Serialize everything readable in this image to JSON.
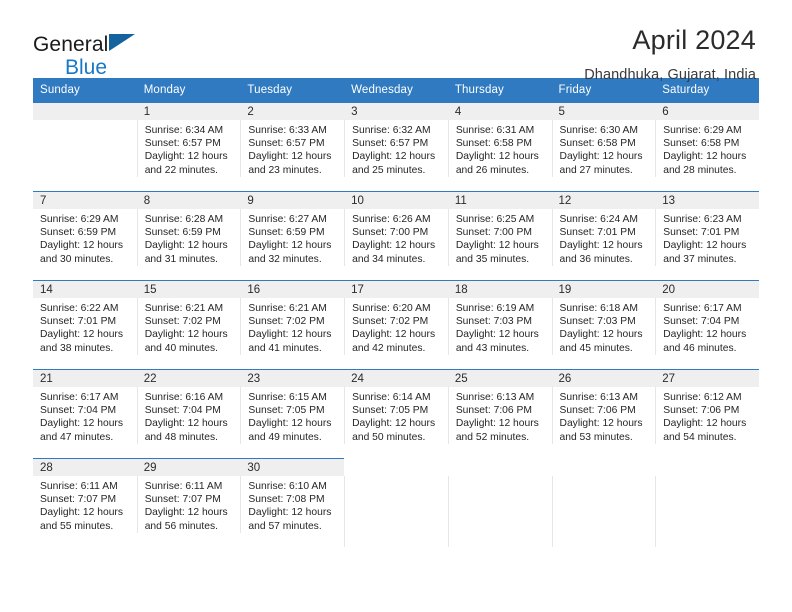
{
  "brand": {
    "line1": "General",
    "line2": "Blue",
    "triangle_color": "#14639e",
    "blue": "#1878c8"
  },
  "header": {
    "title": "April 2024",
    "subtitle": "Dhandhuka, Gujarat, India"
  },
  "theme": {
    "header_bg": "#2f7ac0",
    "daynum_bg": "#efefef",
    "text": "#262626"
  },
  "weekdays": [
    "Sunday",
    "Monday",
    "Tuesday",
    "Wednesday",
    "Thursday",
    "Friday",
    "Saturday"
  ],
  "labels": {
    "sunrise": "Sunrise:",
    "sunset": "Sunset:",
    "daylight": "Daylight:"
  },
  "weeks": [
    [
      {
        "day": "",
        "sunrise": "",
        "sunset": "",
        "daylight_line1": "",
        "daylight_line2": ""
      },
      {
        "day": "1",
        "sunrise": "Sunrise: 6:34 AM",
        "sunset": "Sunset: 6:57 PM",
        "daylight_line1": "Daylight: 12 hours",
        "daylight_line2": "and 22 minutes."
      },
      {
        "day": "2",
        "sunrise": "Sunrise: 6:33 AM",
        "sunset": "Sunset: 6:57 PM",
        "daylight_line1": "Daylight: 12 hours",
        "daylight_line2": "and 23 minutes."
      },
      {
        "day": "3",
        "sunrise": "Sunrise: 6:32 AM",
        "sunset": "Sunset: 6:57 PM",
        "daylight_line1": "Daylight: 12 hours",
        "daylight_line2": "and 25 minutes."
      },
      {
        "day": "4",
        "sunrise": "Sunrise: 6:31 AM",
        "sunset": "Sunset: 6:58 PM",
        "daylight_line1": "Daylight: 12 hours",
        "daylight_line2": "and 26 minutes."
      },
      {
        "day": "5",
        "sunrise": "Sunrise: 6:30 AM",
        "sunset": "Sunset: 6:58 PM",
        "daylight_line1": "Daylight: 12 hours",
        "daylight_line2": "and 27 minutes."
      },
      {
        "day": "6",
        "sunrise": "Sunrise: 6:29 AM",
        "sunset": "Sunset: 6:58 PM",
        "daylight_line1": "Daylight: 12 hours",
        "daylight_line2": "and 28 minutes."
      }
    ],
    [
      {
        "day": "7",
        "sunrise": "Sunrise: 6:29 AM",
        "sunset": "Sunset: 6:59 PM",
        "daylight_line1": "Daylight: 12 hours",
        "daylight_line2": "and 30 minutes."
      },
      {
        "day": "8",
        "sunrise": "Sunrise: 6:28 AM",
        "sunset": "Sunset: 6:59 PM",
        "daylight_line1": "Daylight: 12 hours",
        "daylight_line2": "and 31 minutes."
      },
      {
        "day": "9",
        "sunrise": "Sunrise: 6:27 AM",
        "sunset": "Sunset: 6:59 PM",
        "daylight_line1": "Daylight: 12 hours",
        "daylight_line2": "and 32 minutes."
      },
      {
        "day": "10",
        "sunrise": "Sunrise: 6:26 AM",
        "sunset": "Sunset: 7:00 PM",
        "daylight_line1": "Daylight: 12 hours",
        "daylight_line2": "and 34 minutes."
      },
      {
        "day": "11",
        "sunrise": "Sunrise: 6:25 AM",
        "sunset": "Sunset: 7:00 PM",
        "daylight_line1": "Daylight: 12 hours",
        "daylight_line2": "and 35 minutes."
      },
      {
        "day": "12",
        "sunrise": "Sunrise: 6:24 AM",
        "sunset": "Sunset: 7:01 PM",
        "daylight_line1": "Daylight: 12 hours",
        "daylight_line2": "and 36 minutes."
      },
      {
        "day": "13",
        "sunrise": "Sunrise: 6:23 AM",
        "sunset": "Sunset: 7:01 PM",
        "daylight_line1": "Daylight: 12 hours",
        "daylight_line2": "and 37 minutes."
      }
    ],
    [
      {
        "day": "14",
        "sunrise": "Sunrise: 6:22 AM",
        "sunset": "Sunset: 7:01 PM",
        "daylight_line1": "Daylight: 12 hours",
        "daylight_line2": "and 38 minutes."
      },
      {
        "day": "15",
        "sunrise": "Sunrise: 6:21 AM",
        "sunset": "Sunset: 7:02 PM",
        "daylight_line1": "Daylight: 12 hours",
        "daylight_line2": "and 40 minutes."
      },
      {
        "day": "16",
        "sunrise": "Sunrise: 6:21 AM",
        "sunset": "Sunset: 7:02 PM",
        "daylight_line1": "Daylight: 12 hours",
        "daylight_line2": "and 41 minutes."
      },
      {
        "day": "17",
        "sunrise": "Sunrise: 6:20 AM",
        "sunset": "Sunset: 7:02 PM",
        "daylight_line1": "Daylight: 12 hours",
        "daylight_line2": "and 42 minutes."
      },
      {
        "day": "18",
        "sunrise": "Sunrise: 6:19 AM",
        "sunset": "Sunset: 7:03 PM",
        "daylight_line1": "Daylight: 12 hours",
        "daylight_line2": "and 43 minutes."
      },
      {
        "day": "19",
        "sunrise": "Sunrise: 6:18 AM",
        "sunset": "Sunset: 7:03 PM",
        "daylight_line1": "Daylight: 12 hours",
        "daylight_line2": "and 45 minutes."
      },
      {
        "day": "20",
        "sunrise": "Sunrise: 6:17 AM",
        "sunset": "Sunset: 7:04 PM",
        "daylight_line1": "Daylight: 12 hours",
        "daylight_line2": "and 46 minutes."
      }
    ],
    [
      {
        "day": "21",
        "sunrise": "Sunrise: 6:17 AM",
        "sunset": "Sunset: 7:04 PM",
        "daylight_line1": "Daylight: 12 hours",
        "daylight_line2": "and 47 minutes."
      },
      {
        "day": "22",
        "sunrise": "Sunrise: 6:16 AM",
        "sunset": "Sunset: 7:04 PM",
        "daylight_line1": "Daylight: 12 hours",
        "daylight_line2": "and 48 minutes."
      },
      {
        "day": "23",
        "sunrise": "Sunrise: 6:15 AM",
        "sunset": "Sunset: 7:05 PM",
        "daylight_line1": "Daylight: 12 hours",
        "daylight_line2": "and 49 minutes."
      },
      {
        "day": "24",
        "sunrise": "Sunrise: 6:14 AM",
        "sunset": "Sunset: 7:05 PM",
        "daylight_line1": "Daylight: 12 hours",
        "daylight_line2": "and 50 minutes."
      },
      {
        "day": "25",
        "sunrise": "Sunrise: 6:13 AM",
        "sunset": "Sunset: 7:06 PM",
        "daylight_line1": "Daylight: 12 hours",
        "daylight_line2": "and 52 minutes."
      },
      {
        "day": "26",
        "sunrise": "Sunrise: 6:13 AM",
        "sunset": "Sunset: 7:06 PM",
        "daylight_line1": "Daylight: 12 hours",
        "daylight_line2": "and 53 minutes."
      },
      {
        "day": "27",
        "sunrise": "Sunrise: 6:12 AM",
        "sunset": "Sunset: 7:06 PM",
        "daylight_line1": "Daylight: 12 hours",
        "daylight_line2": "and 54 minutes."
      }
    ],
    [
      {
        "day": "28",
        "sunrise": "Sunrise: 6:11 AM",
        "sunset": "Sunset: 7:07 PM",
        "daylight_line1": "Daylight: 12 hours",
        "daylight_line2": "and 55 minutes."
      },
      {
        "day": "29",
        "sunrise": "Sunrise: 6:11 AM",
        "sunset": "Sunset: 7:07 PM",
        "daylight_line1": "Daylight: 12 hours",
        "daylight_line2": "and 56 minutes."
      },
      {
        "day": "30",
        "sunrise": "Sunrise: 6:10 AM",
        "sunset": "Sunset: 7:08 PM",
        "daylight_line1": "Daylight: 12 hours",
        "daylight_line2": "and 57 minutes."
      },
      {
        "day": "",
        "sunrise": "",
        "sunset": "",
        "daylight_line1": "",
        "daylight_line2": ""
      },
      {
        "day": "",
        "sunrise": "",
        "sunset": "",
        "daylight_line1": "",
        "daylight_line2": ""
      },
      {
        "day": "",
        "sunrise": "",
        "sunset": "",
        "daylight_line1": "",
        "daylight_line2": ""
      },
      {
        "day": "",
        "sunrise": "",
        "sunset": "",
        "daylight_line1": "",
        "daylight_line2": ""
      }
    ]
  ]
}
